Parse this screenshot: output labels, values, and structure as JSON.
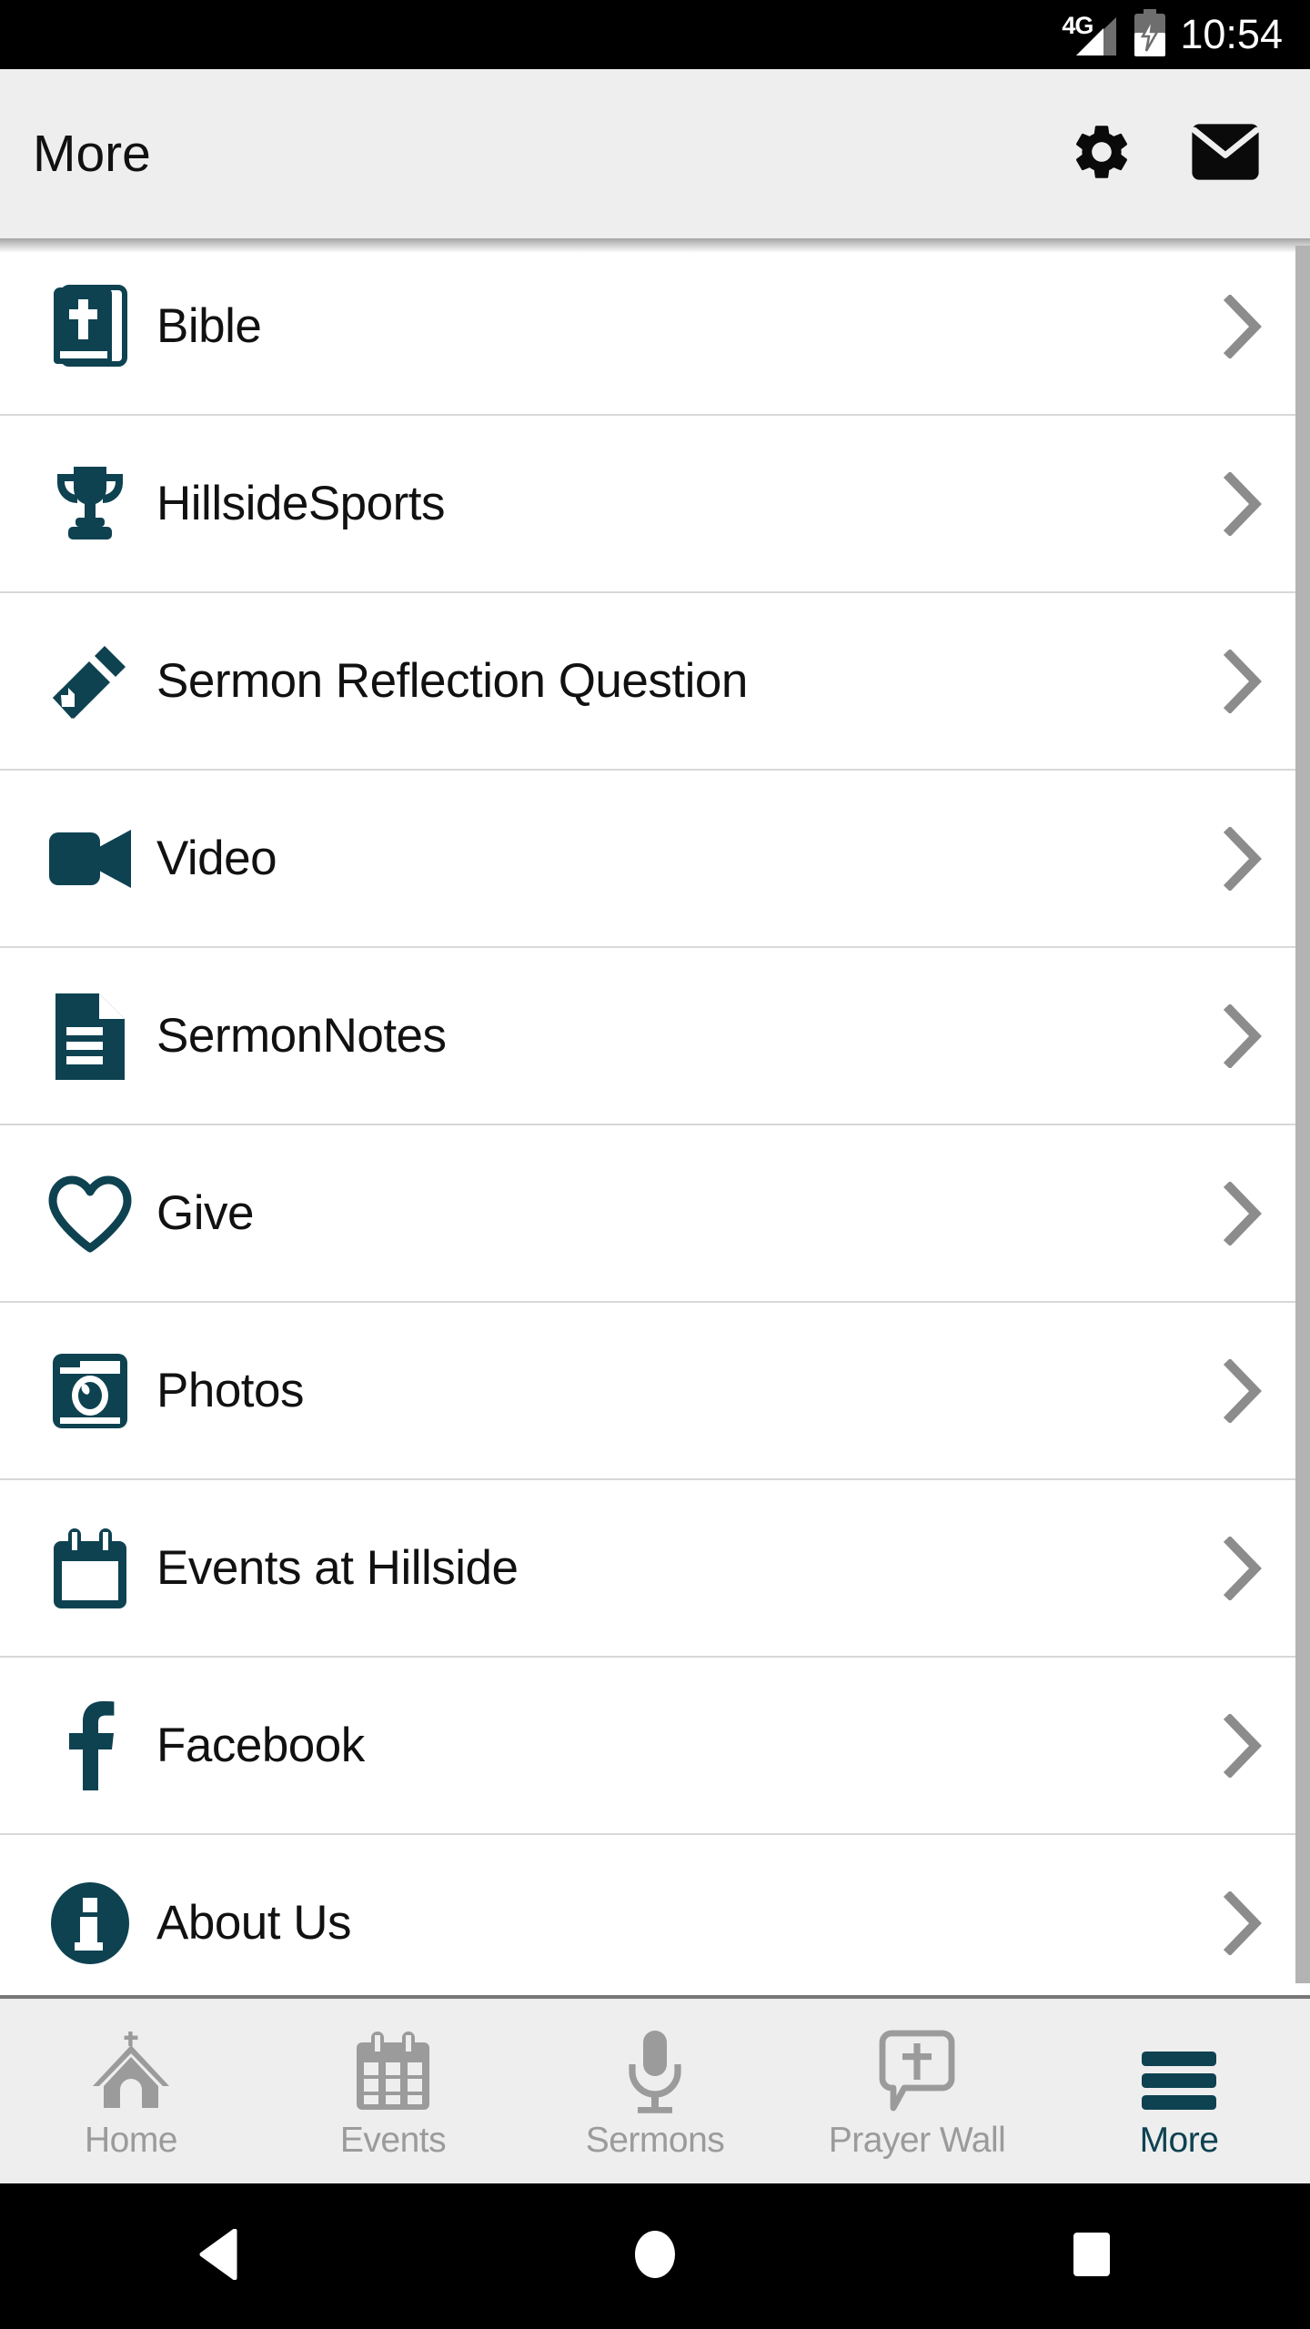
{
  "status_bar": {
    "network_label": "4G",
    "signal_icon": "signal-bars-icon",
    "battery_icon": "battery-charging-icon",
    "clock": "10:54"
  },
  "header": {
    "title": "More",
    "actions": [
      {
        "name": "settings-button",
        "icon": "gear-icon"
      },
      {
        "name": "mail-button",
        "icon": "envelope-icon"
      }
    ]
  },
  "menu": {
    "chevron_icon": "chevron-right-icon",
    "items": [
      {
        "label": "Bible",
        "icon": "bible-book-icon"
      },
      {
        "label": "HillsideSports",
        "icon": "trophy-icon"
      },
      {
        "label": "Sermon Reflection Question",
        "icon": "pencil-icon"
      },
      {
        "label": "Video",
        "icon": "video-camera-icon"
      },
      {
        "label": "SermonNotes",
        "icon": "document-lines-icon"
      },
      {
        "label": "Give",
        "icon": "heart-outline-icon"
      },
      {
        "label": "Photos",
        "icon": "camera-icon"
      },
      {
        "label": "Events at Hillside",
        "icon": "calendar-icon"
      },
      {
        "label": "Facebook",
        "icon": "facebook-f-icon"
      },
      {
        "label": "About Us",
        "icon": "info-circle-icon"
      }
    ]
  },
  "tab_bar": {
    "active": "More",
    "tabs": [
      {
        "label": "Home",
        "icon": "church-icon",
        "active": false
      },
      {
        "label": "Events",
        "icon": "calendar-grid-icon",
        "active": false
      },
      {
        "label": "Sermons",
        "icon": "microphone-icon",
        "active": false
      },
      {
        "label": "Prayer Wall",
        "icon": "speech-bubble-cross-icon",
        "active": false
      },
      {
        "label": "More",
        "icon": "hamburger-menu-icon",
        "active": true
      }
    ]
  },
  "android_nav": {
    "buttons": [
      {
        "name": "back-button",
        "icon": "triangle-back-icon"
      },
      {
        "name": "home-button",
        "icon": "circle-home-icon"
      },
      {
        "name": "recents-button",
        "icon": "square-recents-icon"
      }
    ]
  },
  "colors": {
    "brand_teal": "#0e4251",
    "header_bg": "#eeeeee",
    "divider": "#d8d8d8",
    "chevron": "#8c8c8c",
    "tab_inactive": "#9b9b9b",
    "scrollbar": "#b3b3b3"
  }
}
